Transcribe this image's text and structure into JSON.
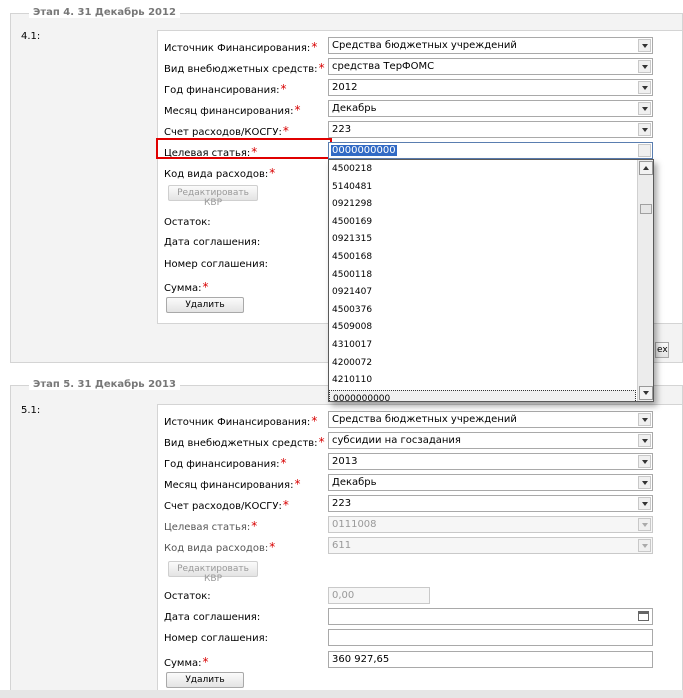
{
  "stage4": {
    "legend": "Этап 4. 31 Декабрь 2012",
    "item_number": "4.1:",
    "labels": {
      "source": "Источник Финансирования:",
      "extrabudget_type": "Вид внебюджетных средств:",
      "year": "Год финансирования:",
      "month": "Месяц финансирования:",
      "account": "Счет расходов/КОСГУ:",
      "target_article": "Целевая статья:",
      "expense_code": "Код вида расходов:",
      "remainder": "Остаток:",
      "agreement_date": "Дата соглашения:",
      "agreement_number": "Номер соглашения:",
      "amount": "Сумма:"
    },
    "values": {
      "source": "Средства бюджетных учреждений",
      "extrabudget_type": "средства ТерФОМС",
      "year": "2012",
      "month": "Декабрь",
      "account": "223",
      "target_article": "0000000000"
    },
    "edit_kvr_button": "Редактировать КВР",
    "delete_button": "Удалить",
    "partial_button": "ex"
  },
  "dropdown": {
    "options": [
      "4500218",
      "5140481",
      "0921298",
      "4500169",
      "0921315",
      "4500168",
      "4500118",
      "0921407",
      "4500376",
      "4509008",
      "4310017",
      "4200072",
      "4210110",
      "0000000000"
    ]
  },
  "stage5": {
    "legend": "Этап 5. 31 Декабрь 2013",
    "item_number": "5.1:",
    "labels": {
      "source": "Источник Финансирования:",
      "extrabudget_type": "Вид внебюджетных средств:",
      "year": "Год финансирования:",
      "month": "Месяц финансирования:",
      "account": "Счет расходов/КОСГУ:",
      "target_article": "Целевая статья:",
      "expense_code": "Код вида расходов:",
      "remainder": "Остаток:",
      "agreement_date": "Дата соглашения:",
      "agreement_number": "Номер соглашения:",
      "amount": "Сумма:"
    },
    "values": {
      "source": "Средства бюджетных учреждений",
      "extrabudget_type": "субсидии на госзадания",
      "year": "2013",
      "month": "Декабрь",
      "account": "223",
      "target_article": "0111008",
      "expense_code": "611",
      "remainder": "0,00",
      "agreement_date": "",
      "agreement_number": "",
      "amount": "360 927,65"
    },
    "edit_kvr_button": "Редактировать КВР",
    "delete_button": "Удалить"
  },
  "colors": {
    "required_star": "#d80000",
    "highlight_border": "#e00000",
    "selection": "#316ac5"
  }
}
